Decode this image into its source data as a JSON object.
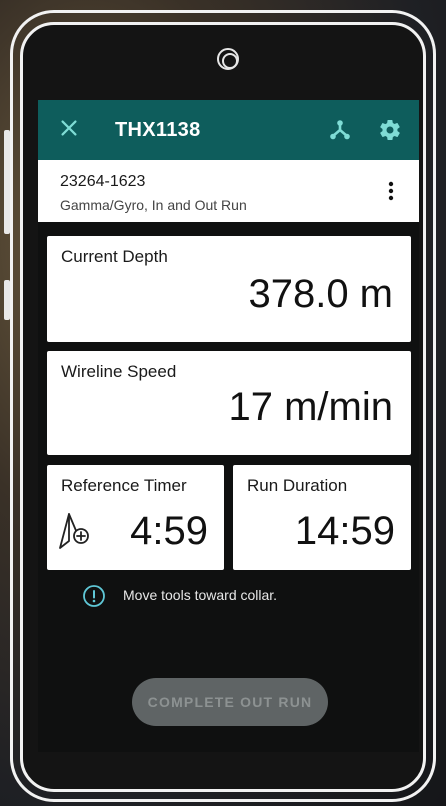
{
  "appbar": {
    "title": "THX1138",
    "close_icon": "close-icon",
    "hub_icon": "hub-icon",
    "settings_icon": "gear-icon",
    "color": "#0e5d5c"
  },
  "job": {
    "code": "23264-1623",
    "description": "Gamma/Gyro, In and Out Run",
    "menu_icon": "more-vert-icon"
  },
  "current_depth": {
    "label": "Current Depth",
    "value": "378.0 m"
  },
  "wireline_speed": {
    "label": "Wireline Speed",
    "value": "17 m/min"
  },
  "reference_timer": {
    "label": "Reference Timer",
    "value": "4:59",
    "icon": "timer-add-icon"
  },
  "run_duration": {
    "label": "Run Duration",
    "value": "14:59"
  },
  "info": {
    "icon": "info-icon",
    "text": "Move tools toward collar.",
    "color": "#5fc7d6"
  },
  "action": {
    "label": "COMPLETE OUT RUN",
    "enabled": false
  }
}
